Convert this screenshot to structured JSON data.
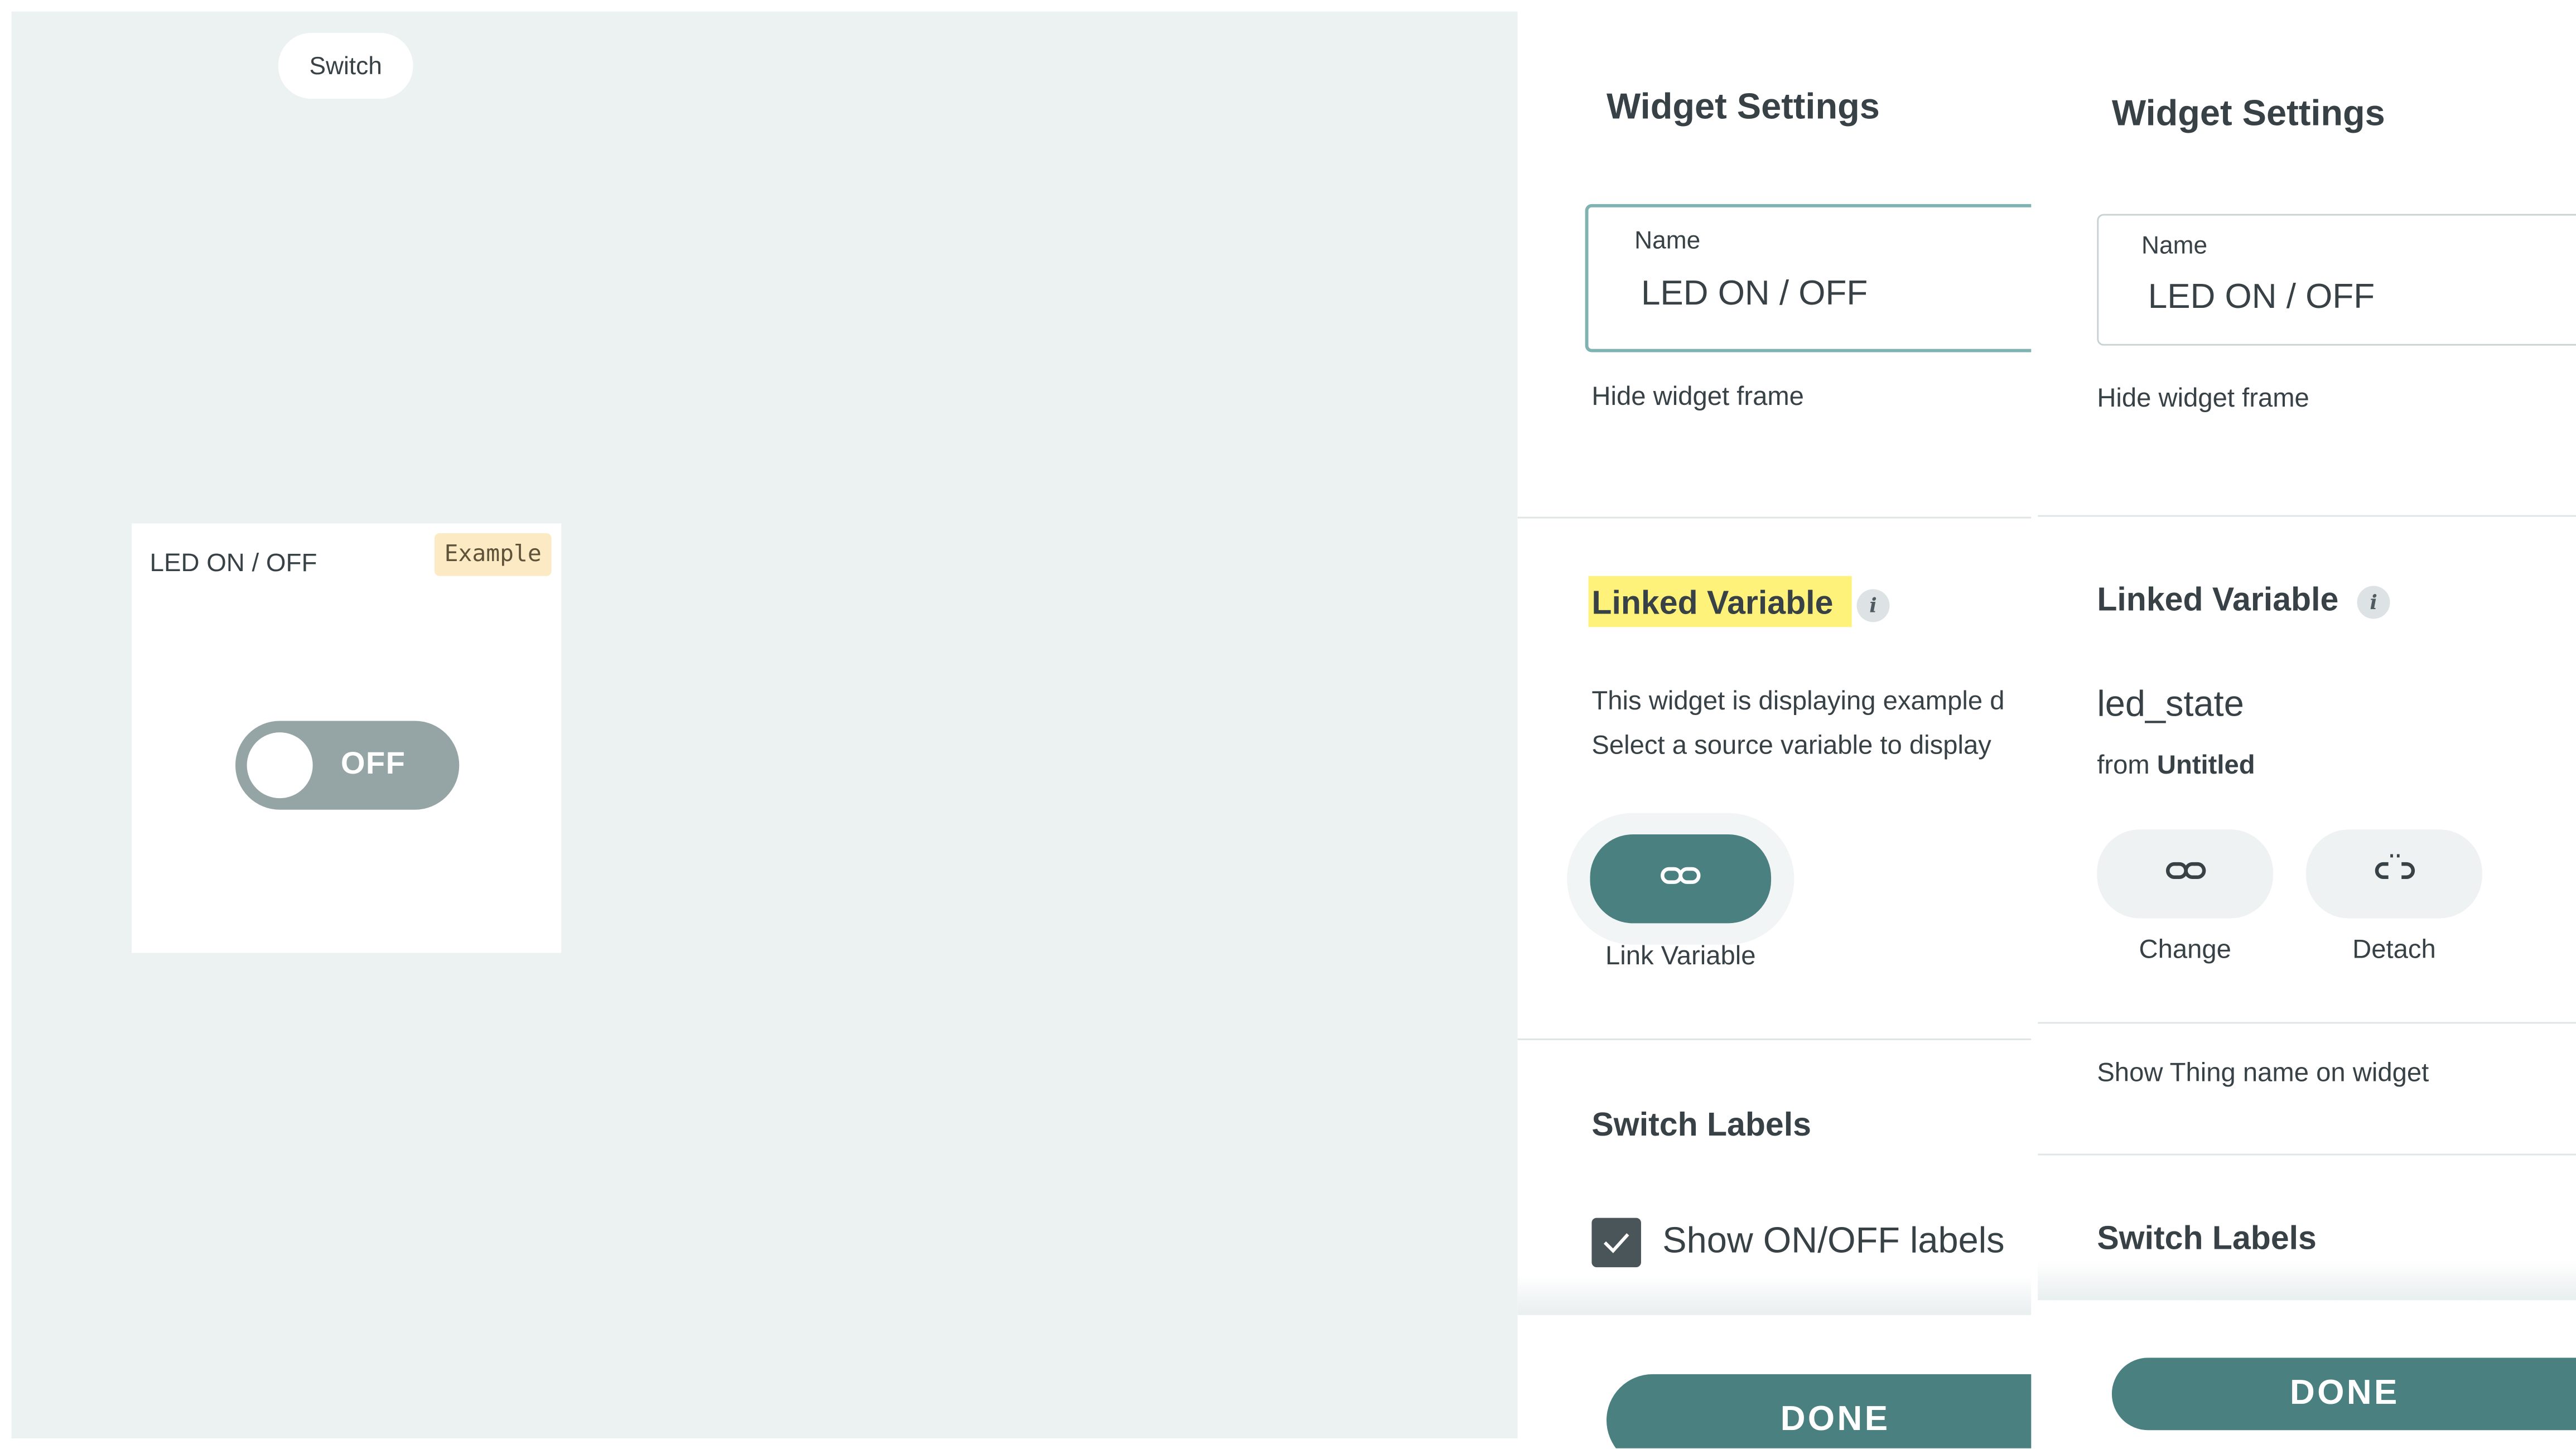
{
  "canvas": {
    "chip_label": "Switch",
    "widget": {
      "title": "LED ON / OFF",
      "badge": "Example",
      "toggle_state": "OFF"
    }
  },
  "panel_example": {
    "heading": "Widget Settings",
    "name_label": "Name",
    "name_value": "LED ON / OFF",
    "hide_frame_label": "Hide widget frame",
    "linked_variable_title": "Linked Variable",
    "info_icon": "info-icon",
    "description_line1": "This widget is displaying example d",
    "description_line2": "Select a source variable to display",
    "link_button_icon": "link-icon",
    "link_button_label": "Link Variable",
    "switch_labels_title": "Switch Labels",
    "show_labels_text": "Show ON/OFF labels",
    "show_labels_checked": true,
    "done_label": "DONE",
    "colors": {
      "accent": "#4a8180",
      "highlight": "#fef27a"
    }
  },
  "panel_linked": {
    "heading": "Widget Settings",
    "name_label": "Name",
    "name_value": "LED ON / OFF",
    "hide_frame_label": "Hide widget frame",
    "linked_variable_title": "Linked Variable",
    "info_icon": "info-icon",
    "variable_name": "led_state",
    "from_prefix": "from",
    "from_thing": "Untitled",
    "change_icon": "link-icon",
    "change_label": "Change",
    "detach_icon": "unlink-icon",
    "detach_label": "Detach",
    "show_thing_name_label": "Show Thing name on widget",
    "switch_labels_title": "Switch Labels",
    "done_label": "DONE"
  }
}
